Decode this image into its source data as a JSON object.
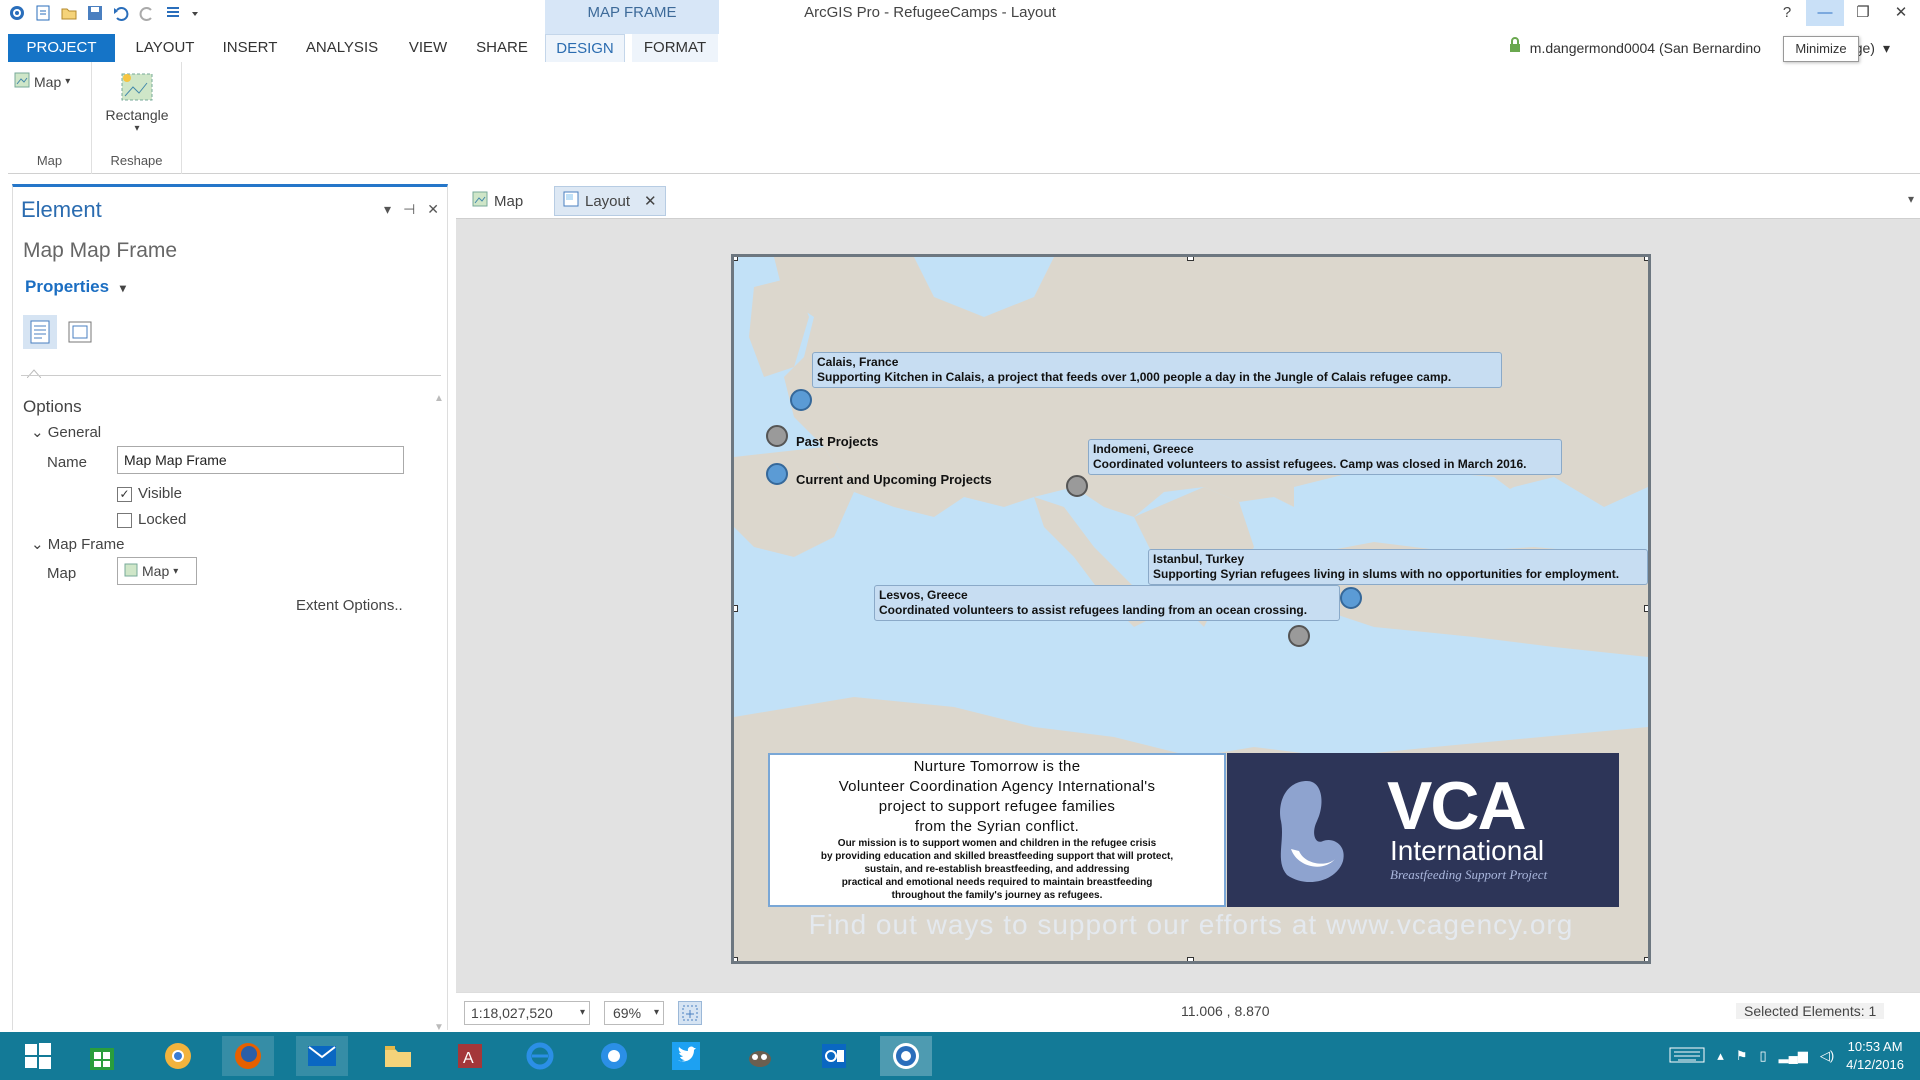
{
  "window": {
    "title": "ArcGIS Pro - RefugeeCamps - Layout",
    "context_tab_header": "MAP FRAME",
    "help": "?",
    "tooltip": "Minimize"
  },
  "ribbon": {
    "tabs": [
      "PROJECT",
      "LAYOUT",
      "INSERT",
      "ANALYSIS",
      "VIEW",
      "SHARE",
      "DESIGN",
      "FORMAT"
    ],
    "active_tab": "DESIGN",
    "user": "m.dangermond0004 (San Bernardino",
    "user_suffix": "ege)",
    "groups": {
      "map": {
        "button_label": "Map",
        "group_label": "Map"
      },
      "reshape": {
        "button_label": "Rectangle",
        "group_label": "Reshape"
      }
    }
  },
  "element_pane": {
    "title": "Element",
    "subtitle": "Map Map Frame",
    "properties_label": "Properties",
    "options_title": "Options",
    "general_section": "General",
    "name_label": "Name",
    "name_value": "Map Map Frame",
    "visible_label": "Visible",
    "visible_checked": true,
    "locked_label": "Locked",
    "locked_checked": false,
    "map_frame_section": "Map Frame",
    "map_label": "Map",
    "map_value": "Map",
    "extent_options": "Extent Options.."
  },
  "view_tabs": [
    "Map",
    "Layout"
  ],
  "layout": {
    "legend": [
      {
        "label": "Past Projects",
        "color": "#9a9a9a"
      },
      {
        "label": "Current and Upcoming Projects",
        "color": "#5b9bd5"
      }
    ],
    "callouts": [
      {
        "title": "Calais, France",
        "text": "Supporting Kitchen in Calais, a project that feeds over 1,000 people a day in the Jungle of Calais refugee camp."
      },
      {
        "title": "Indomeni, Greece",
        "text": "Coordinated volunteers to assist refugees. Camp was closed in March 2016."
      },
      {
        "title": "Istanbul,  Turkey",
        "text": "Supporting Syrian refugees living in slums with no opportunities for employment."
      },
      {
        "title": "Lesvos, Greece",
        "text": "Coordinated volunteers to assist refugees landing from an ocean crossing."
      }
    ],
    "info_heading": [
      "Nurture Tomorrow is the",
      "Volunteer Coordination Agency International's",
      "project to support refugee families",
      "from the Syrian conflict."
    ],
    "info_body": [
      "Our mission is to support women and children in the refugee crisis",
      "by providing education and skilled breastfeeding support that will protect,",
      "sustain, and re-establish breastfeeding, and addressing",
      "practical and emotional needs required to maintain breastfeeding",
      "throughout the family's journey as refugees."
    ],
    "logo": {
      "text": "VCA",
      "sub": "International",
      "tagline": "Breastfeeding Support Project",
      "bg": "#2d3558"
    },
    "footer": "Find out ways to support our efforts at www.vcagency.org"
  },
  "status": {
    "scale": "1:18,027,520",
    "zoom": "69%",
    "coordinates": "11.006 , 8.870",
    "selected": "Selected Elements: 1"
  },
  "taskbar": {
    "time": "10:53 AM",
    "date": "4/12/2016"
  }
}
